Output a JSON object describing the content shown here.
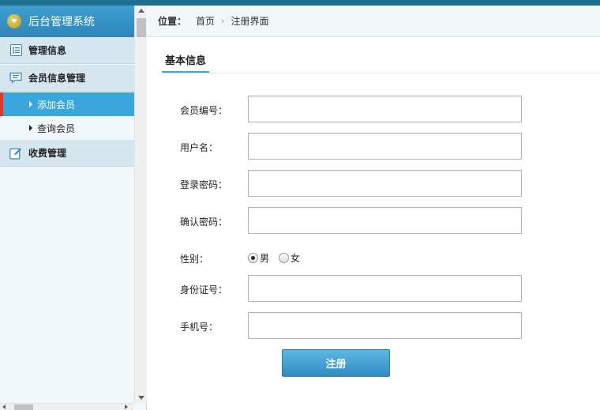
{
  "app": {
    "title": "后台管理系统"
  },
  "sidebar": {
    "groups": [
      {
        "label": "管理信息",
        "icon": "list-icon"
      },
      {
        "label": "会员信息管理",
        "icon": "message-icon"
      },
      {
        "label": "收费管理",
        "icon": "edit-icon"
      }
    ],
    "items": [
      {
        "label": "添加会员",
        "active": true
      },
      {
        "label": "查询会员",
        "active": false
      }
    ]
  },
  "breadcrumb": {
    "label": "位置：",
    "home": "首页",
    "separator": "›",
    "current": "注册界面"
  },
  "section": {
    "title": "基本信息"
  },
  "form": {
    "member_no": {
      "label": "会员编号：",
      "value": ""
    },
    "username": {
      "label": "用户名：",
      "value": ""
    },
    "password": {
      "label": "登录密码：",
      "value": ""
    },
    "confirm": {
      "label": "确认密码：",
      "value": ""
    },
    "gender": {
      "label": "性别：",
      "options": [
        "男",
        "女"
      ],
      "selected": "男"
    },
    "id_card": {
      "label": "身份证号：",
      "value": ""
    },
    "phone": {
      "label": "手机号：",
      "value": ""
    },
    "submit_label": "注册"
  },
  "colors": {
    "accent": "#3aa7dc",
    "header": "#2f86bb",
    "active_marker": "#e0392c"
  }
}
